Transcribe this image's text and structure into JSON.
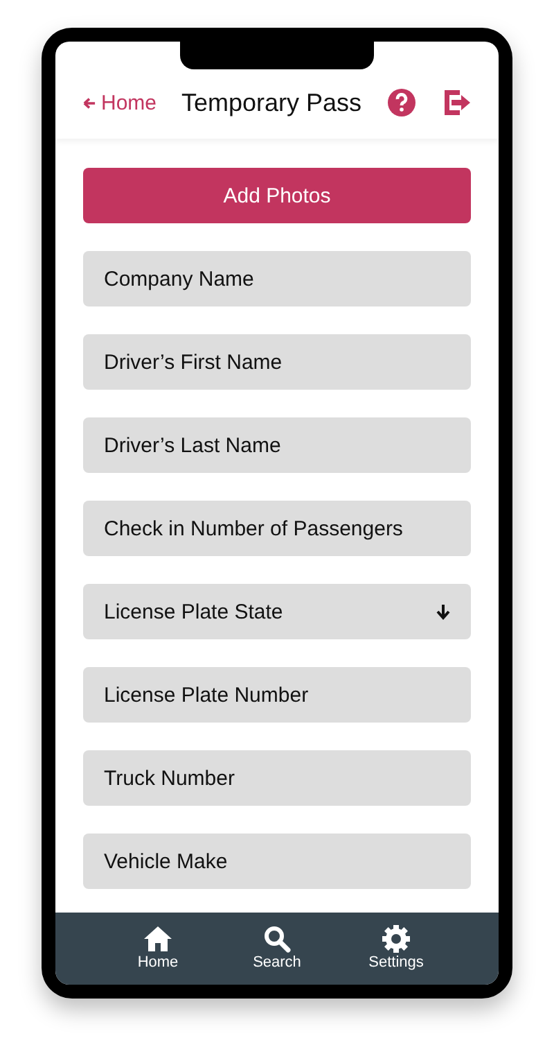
{
  "header": {
    "back_link": "Home",
    "title": "Temporary Pass"
  },
  "add_photos_button": "Add Photos",
  "fields": [
    {
      "kind": "text",
      "placeholder": "Company Name"
    },
    {
      "kind": "text",
      "placeholder": "Driver’s First Name"
    },
    {
      "kind": "text",
      "placeholder": "Driver’s Last Name"
    },
    {
      "kind": "text",
      "placeholder": "Check in Number of Passengers"
    },
    {
      "kind": "select",
      "placeholder": "License Plate State"
    },
    {
      "kind": "text",
      "placeholder": "License Plate Number"
    },
    {
      "kind": "text",
      "placeholder": "Truck Number"
    },
    {
      "kind": "text",
      "placeholder": "Vehicle Make"
    }
  ],
  "bottom_nav": [
    {
      "kind": "home",
      "label": "Home"
    },
    {
      "kind": "search",
      "label": "Search"
    },
    {
      "kind": "settings",
      "label": "Settings"
    }
  ]
}
